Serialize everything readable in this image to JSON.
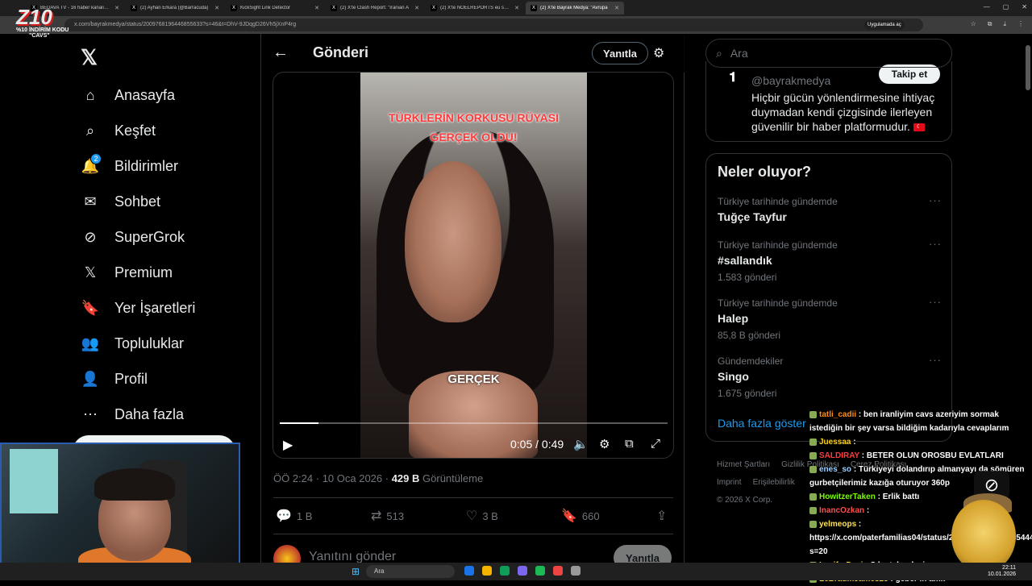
{
  "browser": {
    "tabs": [
      {
        "title": "BEDAVA TV - 16 haber kanalını aç",
        "active": false
      },
      {
        "title": "(2) Ayhan Erkara (@Barracuda)",
        "active": false
      },
      {
        "title": "KickSight Link Detector",
        "active": false
      },
      {
        "title": "(2) X'te Clash Report: \"Iranian A",
        "active": false
      },
      {
        "title": "(2) X'te NOELREPORTS eu se \"h",
        "active": false
      },
      {
        "title": "(2) X'te Bayrak Medya: \"Avrupa",
        "active": true
      }
    ],
    "url": "x.com/bayrakmedya/status/2009768196446855633?s=46&t=DhV-9JDqgD26Vh5jXnP4rg",
    "app_link": "Uygulamada aç"
  },
  "nav": {
    "items": [
      {
        "label": "Anasayfa",
        "icon": "home-icon"
      },
      {
        "label": "Keşfet",
        "icon": "search-icon"
      },
      {
        "label": "Bildirimler",
        "icon": "bell-icon",
        "badge": "2"
      },
      {
        "label": "Sohbet",
        "icon": "mail-icon"
      },
      {
        "label": "SuperGrok",
        "icon": "grok-icon"
      },
      {
        "label": "Premium",
        "icon": "x-icon"
      },
      {
        "label": "Yer İşaretleri",
        "icon": "bookmark-icon"
      },
      {
        "label": "Topluluklar",
        "icon": "communities-icon"
      },
      {
        "label": "Profil",
        "icon": "user-icon"
      },
      {
        "label": "Daha fazla",
        "icon": "more-circle-icon"
      }
    ]
  },
  "post": {
    "header_title": "Gönderi",
    "reply_button": "Yanıtla",
    "video": {
      "overlay_line1": "TÜRKLERİN KORKUSU RÜYASI",
      "overlay_line2": "GERÇEK OLDU!",
      "subtitle": "GERÇEK",
      "time": "0:05 / 0:49",
      "progress": 0.1
    },
    "meta_time": "ÖÖ 2:24 · 10 Oca 2026 · ",
    "views_count": "429 B",
    "views_label": " Görüntüleme",
    "actions": {
      "replies": "1 B",
      "reposts": "513",
      "likes": "3 B",
      "bookmarks": "660"
    },
    "reply_placeholder": "Yanıtını gönder",
    "reply_send": "Yanıtla"
  },
  "search": {
    "placeholder": "Ara"
  },
  "profile_card": {
    "handle": "@bayrakmedya",
    "follow": "Takip et",
    "bio": "Hiçbir gücün yönlendirmesine ihtiyaç duymadan kendi çizgisinde ilerleyen güvenilir bir haber platformudur."
  },
  "trends": {
    "title": "Neler oluyor?",
    "items": [
      {
        "context": "Türkiye tarihinde gündemde",
        "name": "Tuğçe Tayfur",
        "count": ""
      },
      {
        "context": "Türkiye tarihinde gündemde",
        "name": "#sallandık",
        "count": "1.583 gönderi"
      },
      {
        "context": "Türkiye tarihinde gündemde",
        "name": "Halep",
        "count": "85,8 B gönderi"
      },
      {
        "context": "Gündemdekiler",
        "name": "Singo",
        "count": "1.675 gönderi"
      }
    ],
    "show_more": "Daha fazla göster"
  },
  "footer": {
    "links": [
      "Hizmet Şartları",
      "Gizlilik Politikası",
      "Çerez Politikası",
      "Imprint",
      "Erişilebilirlik"
    ],
    "copyright": "© 2026 X Corp."
  },
  "stream": {
    "promo_logo": "Z10",
    "promo_code": "%10 İNDİRİM KODU",
    "promo_cavs": "\"CAVS\"",
    "chat": [
      {
        "user": "tatli_cadii",
        "color": "#ff8c1a",
        "text": ": ben iranliyim cavs azeriyim sormak istediğin bir şey varsa bildiğim kadarıyla cevaplarım"
      },
      {
        "user": "Juessaa",
        "color": "#ffd21a",
        "text": ":"
      },
      {
        "user": "SALDIRAY",
        "color": "#ff3b3b",
        "text": ": BETER OLUN OROSBU EVLATLARI"
      },
      {
        "user": "enes_so",
        "color": "#9ad0ff",
        "text": ": Türkiyeyi dolandırıp almanyayı da sömüren gurbetçilerimiz kazığa oturuyor 360p"
      },
      {
        "user": "HowitzerTaken",
        "color": "#7CFC00",
        "text": ": Erlik battı"
      },
      {
        "user": "InancOzkan",
        "color": "#ff4d4d",
        "text": ":"
      },
      {
        "user": "yelmeops",
        "color": "#ffe14d",
        "text": ": https://x.com/paterfamilias04/status/2009734897951285444?s=20"
      },
      {
        "user": "LuciferDayi",
        "color": "#ffe14d",
        "text": ": Sıkıntı kardeşim ya"
      },
      {
        "user": "LeBraumJames23",
        "color": "#ffe14d",
        "text": ": geber in amk"
      }
    ]
  },
  "taskbar": {
    "search": "Ara",
    "time": "22:11",
    "date": "10.01.2026"
  },
  "colors": {
    "accent": "#1d9bf0",
    "border": "#2f3336",
    "muted": "#71767b"
  }
}
